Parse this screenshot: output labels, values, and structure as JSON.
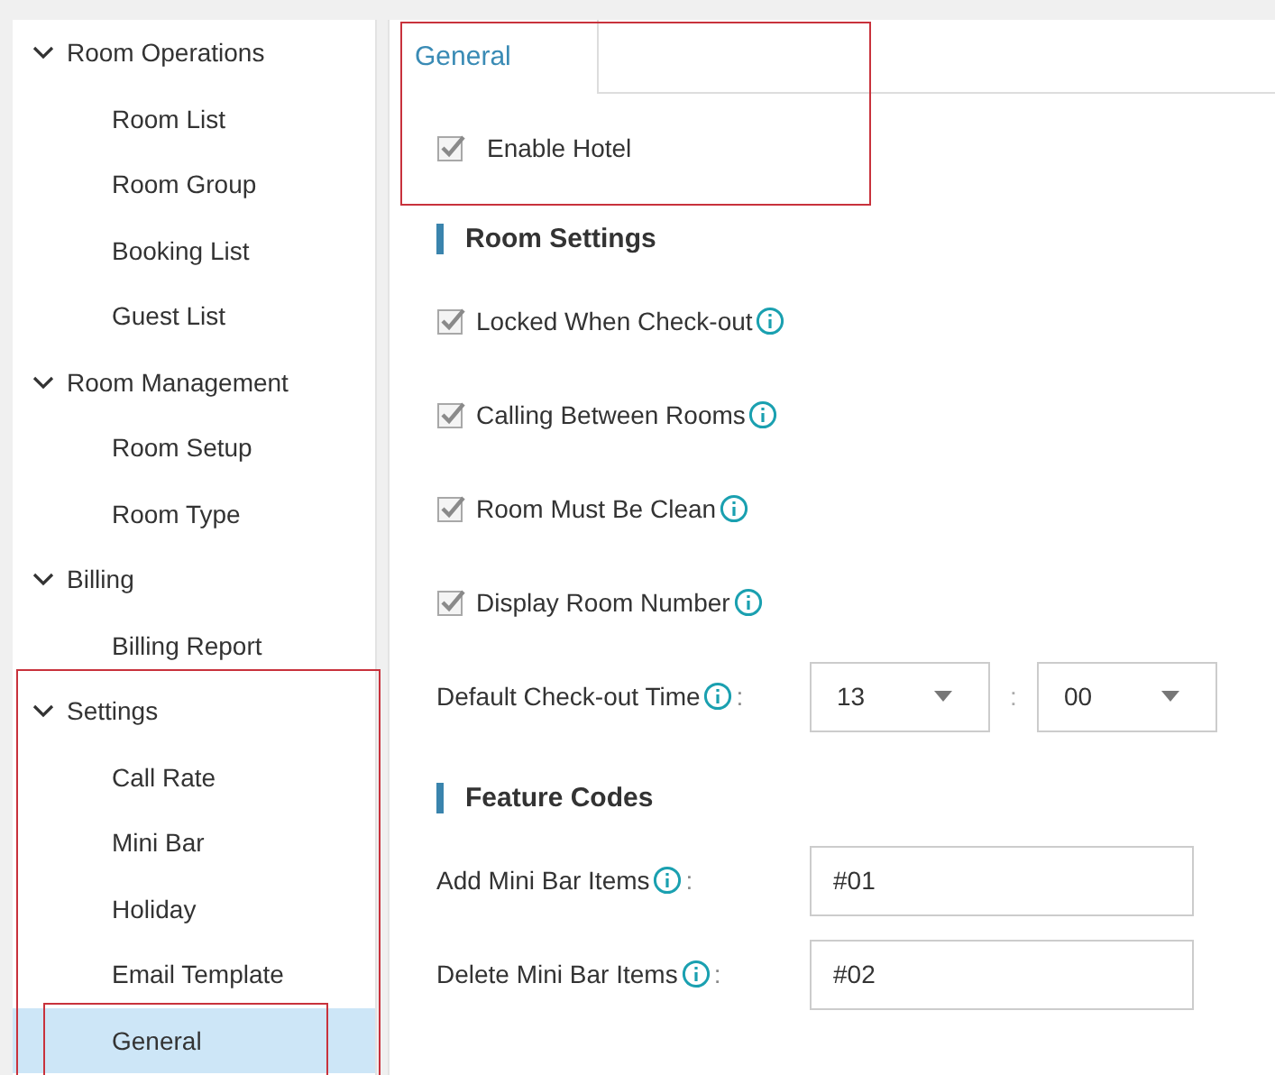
{
  "sidebar": {
    "groups": [
      {
        "label": "Room Operations",
        "expanded": true,
        "children": [
          {
            "label": "Room List",
            "selected": false
          },
          {
            "label": "Room Group",
            "selected": false
          },
          {
            "label": "Booking List",
            "selected": false
          },
          {
            "label": "Guest List",
            "selected": false
          }
        ]
      },
      {
        "label": "Room Management",
        "expanded": true,
        "children": [
          {
            "label": "Room Setup",
            "selected": false
          },
          {
            "label": "Room Type",
            "selected": false
          }
        ]
      },
      {
        "label": "Billing",
        "expanded": true,
        "children": [
          {
            "label": "Billing Report",
            "selected": false
          }
        ]
      },
      {
        "label": "Settings",
        "expanded": true,
        "children": [
          {
            "label": "Call Rate",
            "selected": false
          },
          {
            "label": "Mini Bar",
            "selected": false
          },
          {
            "label": "Holiday",
            "selected": false
          },
          {
            "label": "Email Template",
            "selected": false
          },
          {
            "label": "General",
            "selected": true
          }
        ]
      }
    ]
  },
  "tabs": [
    {
      "label": "General",
      "selected": true
    }
  ],
  "enable_hotel": {
    "label": "Enable Hotel",
    "checked": true
  },
  "sections": [
    {
      "title": "Room Settings",
      "fields": [
        {
          "kind": "checkbox",
          "label": "Locked When Check-out",
          "checked": true,
          "info": true
        },
        {
          "kind": "checkbox",
          "label": "Calling Between Rooms",
          "checked": true,
          "info": true
        },
        {
          "kind": "checkbox",
          "label": "Room Must Be Clean",
          "checked": true,
          "info": true
        },
        {
          "kind": "checkbox",
          "label": "Display Room Number",
          "checked": true,
          "info": true
        },
        {
          "kind": "time",
          "label": "Default Check-out Time",
          "info": true,
          "suffix": ":",
          "hour": "13",
          "separator": ":",
          "minute": "00"
        }
      ]
    },
    {
      "title": "Feature Codes",
      "fields": [
        {
          "kind": "text",
          "label": "Add Mini Bar Items",
          "info": true,
          "suffix": ":",
          "value": "#01"
        },
        {
          "kind": "text",
          "label": "Delete Mini Bar Items",
          "info": true,
          "suffix": ":",
          "value": "#02"
        }
      ]
    }
  ]
}
